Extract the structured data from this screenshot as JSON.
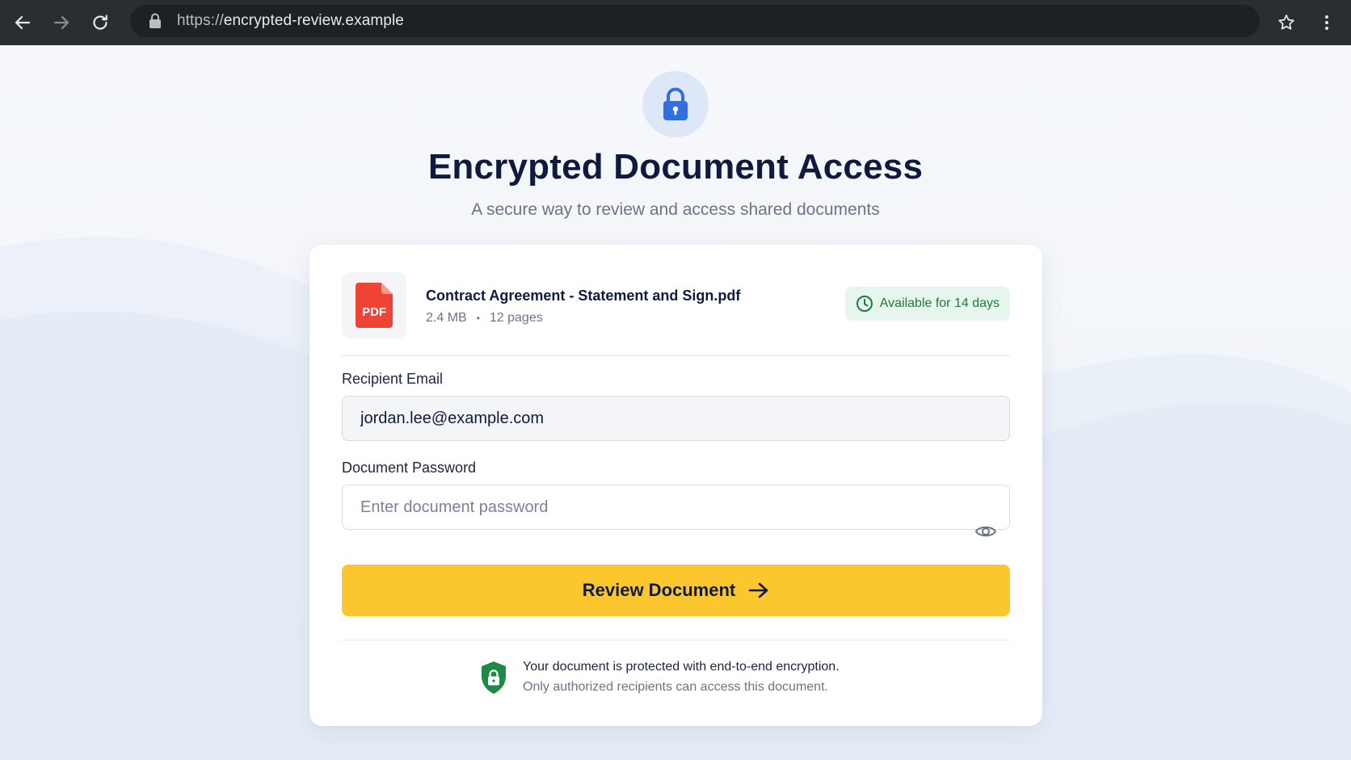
{
  "browser": {
    "url_scheme": "https://",
    "url_host": "encrypted-review.example"
  },
  "header": {
    "title": "Encrypted Document Access",
    "subtitle": "A secure way to review and access shared documents"
  },
  "file": {
    "icon_label": "PDF",
    "name": "Contract Agreement - Statement and Sign.pdf",
    "size": "2.4 MB",
    "separator": "•",
    "pages": "12 pages",
    "availability": "Available for 14 days"
  },
  "form": {
    "email_label": "Recipient Email",
    "email_value": "jordan.lee@example.com",
    "password_label": "Document Password",
    "password_placeholder": "Enter document password",
    "submit_label": "Review Document"
  },
  "security": {
    "line1": "Your document is protected with end-to-end encryption.",
    "line2": "Only authorized recipients can access this document."
  },
  "colors": {
    "accent_button": "#fcc72e",
    "primary_blue": "#2f6fe0",
    "success_green": "#1b7a3a",
    "pdf_red": "#ee4436",
    "title_navy": "#0f1b3d"
  },
  "icons": {
    "back": "back-arrow-icon",
    "forward": "forward-arrow-icon",
    "reload": "reload-icon",
    "address_lock": "lock-icon",
    "bookmark": "star-icon",
    "menu": "kebab-menu-icon",
    "hero": "padlock-icon",
    "file": "pdf-file-icon",
    "availability": "clock-icon",
    "password_toggle": "eye-icon",
    "submit": "arrow-right-icon",
    "security": "shield-lock-icon"
  }
}
